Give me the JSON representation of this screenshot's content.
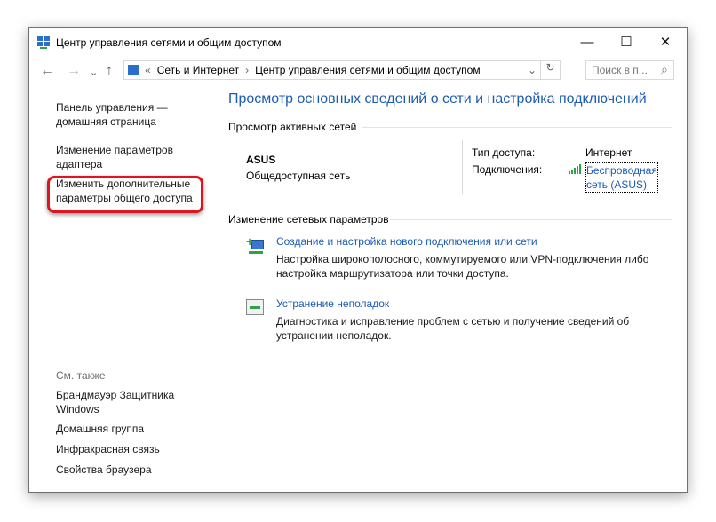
{
  "window": {
    "title": "Центр управления сетями и общим доступом",
    "minimize": "—",
    "maximize": "☐",
    "close": "✕"
  },
  "nav": {
    "back": "←",
    "forward": "→",
    "recent": "⌄",
    "up": "↑",
    "refresh": "↻"
  },
  "address": {
    "prefix": "«",
    "crumbs": [
      "Сеть и Интернет",
      "Центр управления сетями и общим доступом"
    ],
    "sep": "›",
    "dropdown": "⌄"
  },
  "search": {
    "placeholder": "Поиск в п...",
    "icon": "⌕"
  },
  "sidebar": {
    "home": "Панель управления — домашняя страница",
    "items": [
      "Изменение параметров адаптера",
      "Изменить дополнительные параметры общего доступа"
    ],
    "see_also": "См. также",
    "see_links": [
      "Брандмауэр Защитника Windows",
      "Домашняя группа",
      "Инфракрасная связь",
      "Свойства браузера"
    ]
  },
  "main": {
    "title": "Просмотр основных сведений о сети и настройка подключений",
    "active_header": "Просмотр активных сетей",
    "network_name": "ASUS",
    "network_type": "Общедоступная сеть",
    "access_label": "Тип доступа:",
    "access_value": "Интернет",
    "conn_label": "Подключения:",
    "conn_value": "Беспроводная сеть (ASUS)",
    "change_header": "Изменение сетевых параметров",
    "tasks": [
      {
        "link": "Создание и настройка нового подключения или сети",
        "desc": "Настройка широкополосного, коммутируемого или VPN-подключения либо настройка маршрутизатора или точки доступа."
      },
      {
        "link": "Устранение неполадок",
        "desc": "Диагностика и исправление проблем с сетью и получение сведений об устранении неполадок."
      }
    ]
  },
  "colors": {
    "link": "#1c5bb4",
    "highlight": "#e0141e"
  }
}
